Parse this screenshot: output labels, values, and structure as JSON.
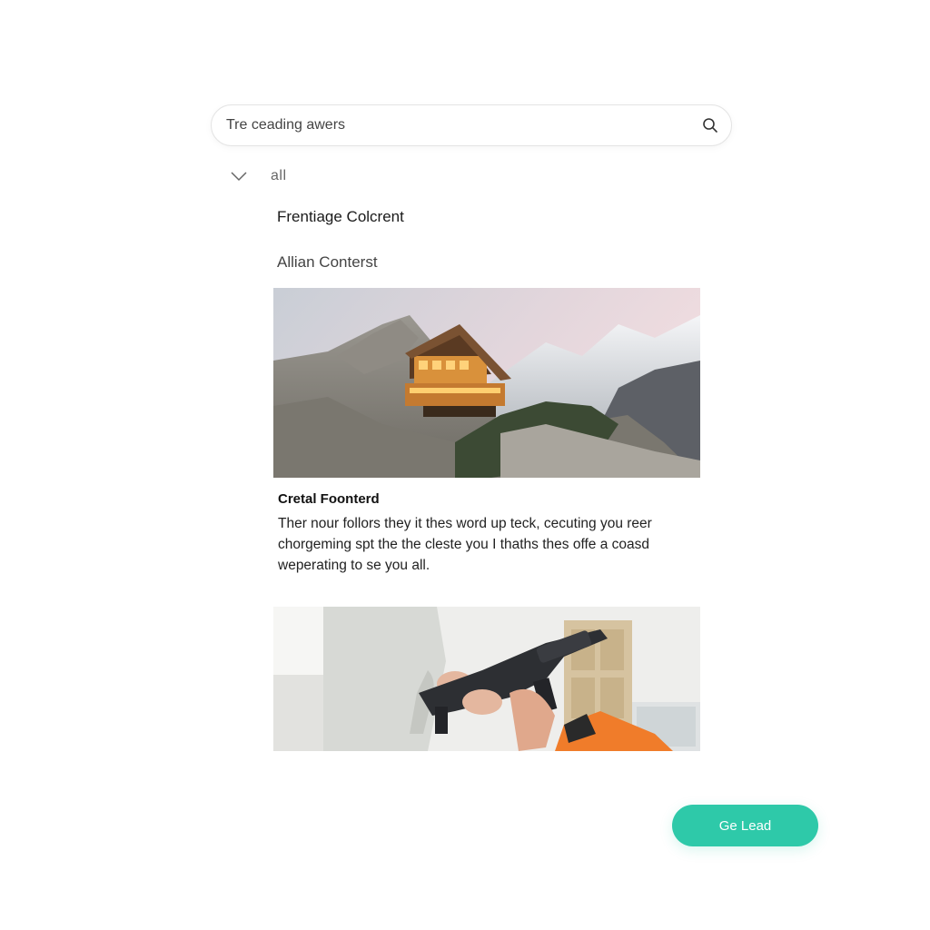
{
  "search": {
    "value": "Tre ceading awers",
    "icon": "search-icon"
  },
  "filter": {
    "icon": "chevron-down-icon",
    "label": "all"
  },
  "headings": {
    "primary": "Frentiage Colcrent",
    "secondary": "Allian Conterst"
  },
  "article": {
    "title": "Cretal Foonterd",
    "body_lines": [
      "Ther nour follors they it thes word up teck, cecuting you reer",
      "chorgeming spt the the cleste you I thaths thes offe a coasd",
      "weperating to se you all."
    ]
  },
  "cta": {
    "label": "Ge Lead"
  },
  "colors": {
    "accent": "#2ec9a9",
    "border": "#e4e4e4"
  }
}
